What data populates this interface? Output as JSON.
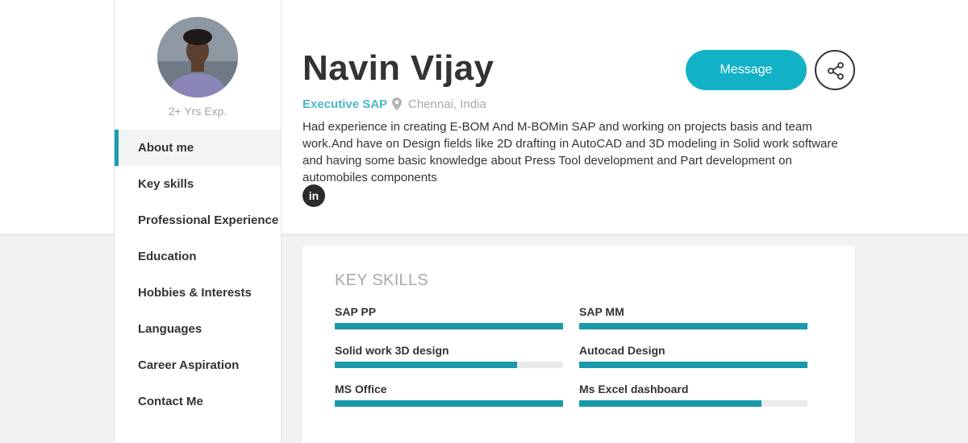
{
  "profile": {
    "name": "Navin Vijay",
    "role": "Executive SAP",
    "location": "Chennai, India",
    "experience": "2+ Yrs Exp.",
    "about": "Had experience in creating E-BOM And M-BOMin SAP and working on projects basis and team work.And have on Design fields like 2D drafting in AutoCAD and 3D modeling in Solid work software and having some basic knowledge about Press Tool development and Part development on automobiles components",
    "linkedin_glyph": "in"
  },
  "actions": {
    "message_label": "Message"
  },
  "sidebar": {
    "items": [
      {
        "label": "About me"
      },
      {
        "label": "Key skills"
      },
      {
        "label": "Professional Experience"
      },
      {
        "label": "Education"
      },
      {
        "label": "Hobbies & Interests"
      },
      {
        "label": "Languages"
      },
      {
        "label": "Career Aspiration"
      },
      {
        "label": "Contact Me"
      }
    ]
  },
  "skills": {
    "title": "KEY SKILLS",
    "items": [
      {
        "label": "SAP PP",
        "level": 1.0
      },
      {
        "label": "SAP MM",
        "level": 1.0
      },
      {
        "label": "Solid work 3D design",
        "level": 0.8
      },
      {
        "label": "Autocad Design",
        "level": 1.0
      },
      {
        "label": "MS Office",
        "level": 1.0
      },
      {
        "label": "Ms Excel dashboard",
        "level": 0.8
      }
    ]
  },
  "colors": {
    "accent": "#12b2c6",
    "bar_fill": "#1a99ab",
    "role_text": "#4bb8c5"
  },
  "icons": {
    "location": "map-pin-icon",
    "share": "share-icon",
    "linkedin": "linkedin-icon"
  }
}
